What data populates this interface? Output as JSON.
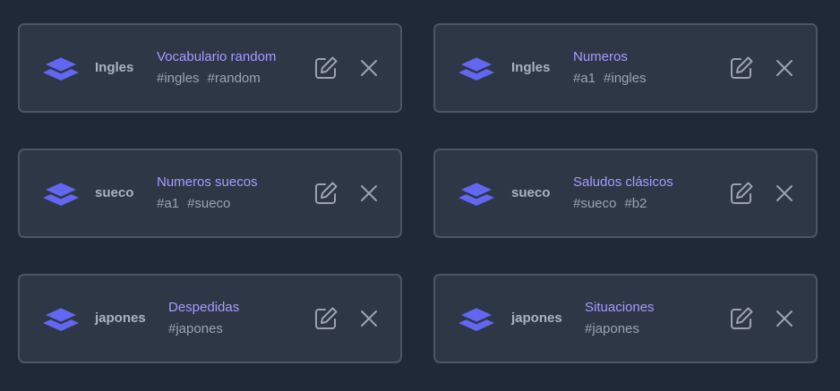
{
  "cards": [
    {
      "language": "Ingles",
      "title": "Vocabulario random",
      "tags": [
        "#ingles",
        "#random"
      ]
    },
    {
      "language": "Ingles",
      "title": "Numeros",
      "tags": [
        "#a1",
        "#ingles"
      ]
    },
    {
      "language": "sueco",
      "title": "Numeros suecos",
      "tags": [
        "#a1",
        "#sueco"
      ]
    },
    {
      "language": "sueco",
      "title": "Saludos clásicos",
      "tags": [
        "#sueco",
        "#b2"
      ]
    },
    {
      "language": "japones",
      "title": "Despedidas",
      "tags": [
        "#japones"
      ]
    },
    {
      "language": "japones",
      "title": "Situaciones",
      "tags": [
        "#japones"
      ]
    }
  ],
  "icons": {
    "deck": "layers-icon",
    "edit": "edit-icon",
    "delete": "close-icon"
  },
  "colors": {
    "background": "#1f2937",
    "card": "#2d3746",
    "border": "#4b5563",
    "accent": "#6366f1",
    "title": "#a59cff",
    "tags": "#9ca3af",
    "language": "#aab2bf"
  }
}
